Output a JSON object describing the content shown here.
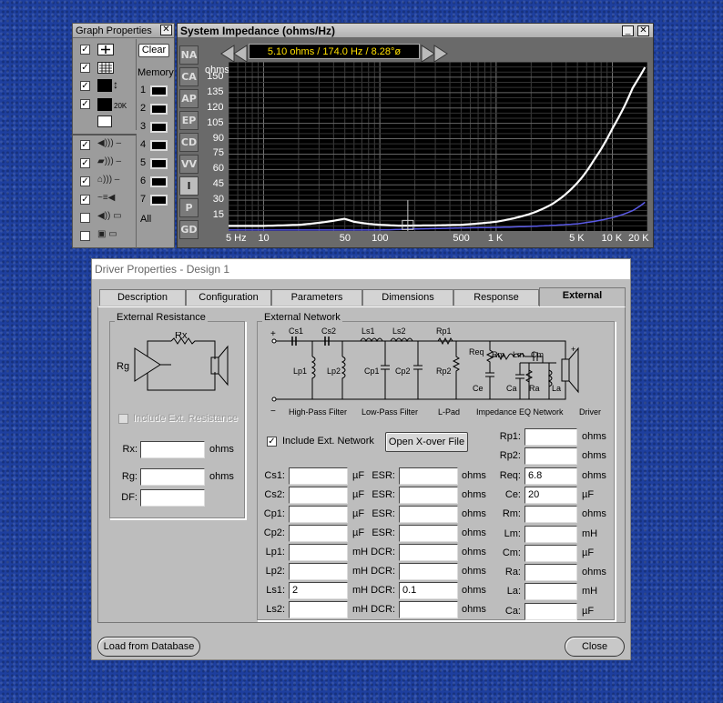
{
  "graph_props": {
    "title": "Graph Properties",
    "close": "✕",
    "clear": "Clear",
    "memory": "Memory",
    "mem_items": [
      "1",
      "2",
      "3",
      "4",
      "5",
      "6",
      "7"
    ],
    "all": "All",
    "ico_20k": "20K"
  },
  "impedance": {
    "title": "System Impedance (ohms/Hz)",
    "readout": "5.10 ohms / 174.0 Hz / 8.28°ø",
    "min": "_",
    "close": "✕",
    "views": [
      "NA",
      "CA",
      "AP",
      "EP",
      "CD",
      "VV",
      "I",
      "P",
      "GD"
    ],
    "selected_view": "I",
    "y_unit": "ohms",
    "y_ticks": [
      "150",
      "135",
      "120",
      "105",
      "90",
      "75",
      "60",
      "45",
      "30",
      "15"
    ],
    "x_ticks": [
      "5 Hz",
      "10",
      "50",
      "100",
      "500",
      "1 K",
      "5 K",
      "10 K",
      "20 K"
    ]
  },
  "chart_data": {
    "type": "line",
    "xlabel": "",
    "ylabel": "ohms",
    "xscale": "log",
    "xlim": [
      5,
      20000
    ],
    "ylim": [
      0,
      165
    ],
    "grid": true,
    "series": [
      {
        "color": "#ffffff",
        "x": [
          5,
          10,
          20,
          30,
          40,
          50,
          60,
          80,
          100,
          150,
          200,
          300,
          500,
          1000,
          2000,
          3000,
          5000,
          7000,
          10000,
          15000,
          20000
        ],
        "y": [
          5,
          5,
          6,
          8,
          10,
          12,
          9,
          7,
          6,
          5.2,
          5.3,
          5.5,
          6,
          9,
          17,
          26,
          47,
          70,
          100,
          140,
          164
        ]
      },
      {
        "color": "#5a5ae6",
        "x": [
          5,
          100,
          200,
          500,
          1000,
          2000,
          5000,
          10000,
          15000,
          20000
        ],
        "y": [
          1,
          1,
          2,
          3,
          3.5,
          4.5,
          7,
          13,
          20,
          30
        ]
      }
    ]
  },
  "driver": {
    "title": "Driver Properties - Design 1",
    "tabs": [
      "Description",
      "Configuration",
      "Parameters",
      "Dimensions",
      "Response",
      "External"
    ],
    "selected_tab": "External",
    "ext_res": {
      "group": "External Resistance",
      "rx_sym": "Rx",
      "rg_sym": "Rg",
      "include": "Include Ext. Resistance",
      "rx": "Rx:",
      "rg": "Rg:",
      "df": "DF:",
      "ohms": "ohms"
    },
    "ext_net": {
      "group": "External Network",
      "syms": {
        "cs1": "Cs1",
        "cs2": "Cs2",
        "ls1": "Ls1",
        "ls2": "Ls2",
        "rp1": "Rp1",
        "lp1": "Lp1",
        "lp2": "Lp2",
        "cp1": "Cp1",
        "cp2": "Cp2",
        "rp2": "Rp2",
        "req": "Req",
        "rm": "Rm",
        "lm": "Lm",
        "cm": "Cm",
        "ce": "Ce",
        "ca": "Ca",
        "ra": "Ra",
        "la": "La",
        "plus": "+",
        "minus": "−"
      },
      "captions": [
        "High-Pass Filter",
        "Low-Pass Filter",
        "L-Pad",
        "Impedance EQ Network",
        "Driver"
      ],
      "include": "Include Ext. Network",
      "open": "Open X-over File"
    },
    "fields_left": [
      {
        "label": "Cs1:",
        "value": "",
        "unit": "µF",
        "label2": "ESR:",
        "value2": "",
        "unit2": "ohms"
      },
      {
        "label": "Cs2:",
        "value": "",
        "unit": "µF",
        "label2": "ESR:",
        "value2": "",
        "unit2": "ohms"
      },
      {
        "label": "Cp1:",
        "value": "",
        "unit": "µF",
        "label2": "ESR:",
        "value2": "",
        "unit2": "ohms"
      },
      {
        "label": "Cp2:",
        "value": "",
        "unit": "µF",
        "label2": "ESR:",
        "value2": "",
        "unit2": "ohms"
      },
      {
        "label": "Lp1:",
        "value": "",
        "unit": "mH",
        "label2": "DCR:",
        "value2": "",
        "unit2": "ohms"
      },
      {
        "label": "Lp2:",
        "value": "",
        "unit": "mH",
        "label2": "DCR:",
        "value2": "",
        "unit2": "ohms"
      },
      {
        "label": "Ls1:",
        "value": "2",
        "unit": "mH",
        "label2": "DCR:",
        "value2": "0.1",
        "unit2": "ohms"
      },
      {
        "label": "Ls2:",
        "value": "",
        "unit": "mH",
        "label2": "DCR:",
        "value2": "",
        "unit2": "ohms"
      }
    ],
    "fields_right": [
      {
        "label": "Rp1:",
        "value": "",
        "unit": "ohms"
      },
      {
        "label": "Rp2:",
        "value": "",
        "unit": "ohms"
      },
      {
        "label": "Req:",
        "value": "6.8",
        "unit": "ohms"
      },
      {
        "label": "Ce:",
        "value": "20",
        "unit": "µF"
      },
      {
        "label": "Rm:",
        "value": "",
        "unit": "ohms"
      },
      {
        "label": "Lm:",
        "value": "",
        "unit": "mH"
      },
      {
        "label": "Cm:",
        "value": "",
        "unit": "µF"
      },
      {
        "label": "Ra:",
        "value": "",
        "unit": "ohms"
      },
      {
        "label": "La:",
        "value": "",
        "unit": "mH"
      },
      {
        "label": "Ca:",
        "value": "",
        "unit": "µF"
      }
    ],
    "load_db": "Load from Database",
    "close": "Close"
  }
}
